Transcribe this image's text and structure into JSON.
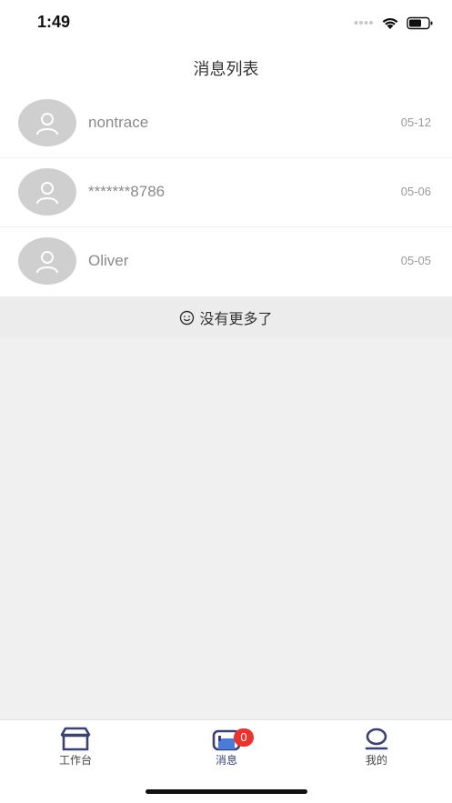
{
  "status_bar": {
    "time": "1:49",
    "icons": [
      "signal-dots-icon",
      "wifi-icon",
      "battery-icon"
    ]
  },
  "nav": {
    "title": "消息列表"
  },
  "messages": [
    {
      "name": "nontrace",
      "date": "05-12",
      "avatar_icon": "user-icon"
    },
    {
      "name": "*******8786",
      "date": "05-06",
      "avatar_icon": "user-icon"
    },
    {
      "name": "Oliver",
      "date": "05-05",
      "avatar_icon": "user-icon"
    }
  ],
  "footer_note": {
    "icon": "smile-icon",
    "text": "没有更多了"
  },
  "tabs": [
    {
      "label": "工作台",
      "icon": "store-icon",
      "active": false
    },
    {
      "label": "消息",
      "icon": "message-icon",
      "active": true,
      "badge": "0"
    },
    {
      "label": "我的",
      "icon": "profile-icon",
      "active": false
    }
  ],
  "colors": {
    "accent": "#3a4270",
    "badge": "#e8332e",
    "avatar_bg": "#cfcfcf",
    "page_bg": "#f0f0f0"
  }
}
